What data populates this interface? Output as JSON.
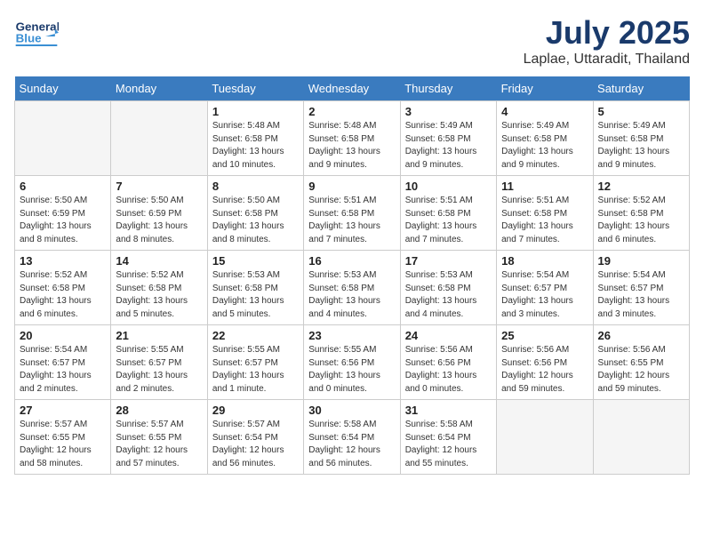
{
  "header": {
    "logo_text_general": "General",
    "logo_text_blue": "Blue",
    "month_year": "July 2025",
    "location": "Laplae, Uttaradit, Thailand"
  },
  "weekdays": [
    "Sunday",
    "Monday",
    "Tuesday",
    "Wednesday",
    "Thursday",
    "Friday",
    "Saturday"
  ],
  "weeks": [
    [
      {
        "day": "",
        "info": ""
      },
      {
        "day": "",
        "info": ""
      },
      {
        "day": "1",
        "info": "Sunrise: 5:48 AM\nSunset: 6:58 PM\nDaylight: 13 hours\nand 10 minutes."
      },
      {
        "day": "2",
        "info": "Sunrise: 5:48 AM\nSunset: 6:58 PM\nDaylight: 13 hours\nand 9 minutes."
      },
      {
        "day": "3",
        "info": "Sunrise: 5:49 AM\nSunset: 6:58 PM\nDaylight: 13 hours\nand 9 minutes."
      },
      {
        "day": "4",
        "info": "Sunrise: 5:49 AM\nSunset: 6:58 PM\nDaylight: 13 hours\nand 9 minutes."
      },
      {
        "day": "5",
        "info": "Sunrise: 5:49 AM\nSunset: 6:58 PM\nDaylight: 13 hours\nand 9 minutes."
      }
    ],
    [
      {
        "day": "6",
        "info": "Sunrise: 5:50 AM\nSunset: 6:59 PM\nDaylight: 13 hours\nand 8 minutes."
      },
      {
        "day": "7",
        "info": "Sunrise: 5:50 AM\nSunset: 6:59 PM\nDaylight: 13 hours\nand 8 minutes."
      },
      {
        "day": "8",
        "info": "Sunrise: 5:50 AM\nSunset: 6:58 PM\nDaylight: 13 hours\nand 8 minutes."
      },
      {
        "day": "9",
        "info": "Sunrise: 5:51 AM\nSunset: 6:58 PM\nDaylight: 13 hours\nand 7 minutes."
      },
      {
        "day": "10",
        "info": "Sunrise: 5:51 AM\nSunset: 6:58 PM\nDaylight: 13 hours\nand 7 minutes."
      },
      {
        "day": "11",
        "info": "Sunrise: 5:51 AM\nSunset: 6:58 PM\nDaylight: 13 hours\nand 7 minutes."
      },
      {
        "day": "12",
        "info": "Sunrise: 5:52 AM\nSunset: 6:58 PM\nDaylight: 13 hours\nand 6 minutes."
      }
    ],
    [
      {
        "day": "13",
        "info": "Sunrise: 5:52 AM\nSunset: 6:58 PM\nDaylight: 13 hours\nand 6 minutes."
      },
      {
        "day": "14",
        "info": "Sunrise: 5:52 AM\nSunset: 6:58 PM\nDaylight: 13 hours\nand 5 minutes."
      },
      {
        "day": "15",
        "info": "Sunrise: 5:53 AM\nSunset: 6:58 PM\nDaylight: 13 hours\nand 5 minutes."
      },
      {
        "day": "16",
        "info": "Sunrise: 5:53 AM\nSunset: 6:58 PM\nDaylight: 13 hours\nand 4 minutes."
      },
      {
        "day": "17",
        "info": "Sunrise: 5:53 AM\nSunset: 6:58 PM\nDaylight: 13 hours\nand 4 minutes."
      },
      {
        "day": "18",
        "info": "Sunrise: 5:54 AM\nSunset: 6:57 PM\nDaylight: 13 hours\nand 3 minutes."
      },
      {
        "day": "19",
        "info": "Sunrise: 5:54 AM\nSunset: 6:57 PM\nDaylight: 13 hours\nand 3 minutes."
      }
    ],
    [
      {
        "day": "20",
        "info": "Sunrise: 5:54 AM\nSunset: 6:57 PM\nDaylight: 13 hours\nand 2 minutes."
      },
      {
        "day": "21",
        "info": "Sunrise: 5:55 AM\nSunset: 6:57 PM\nDaylight: 13 hours\nand 2 minutes."
      },
      {
        "day": "22",
        "info": "Sunrise: 5:55 AM\nSunset: 6:57 PM\nDaylight: 13 hours\nand 1 minute."
      },
      {
        "day": "23",
        "info": "Sunrise: 5:55 AM\nSunset: 6:56 PM\nDaylight: 13 hours\nand 0 minutes."
      },
      {
        "day": "24",
        "info": "Sunrise: 5:56 AM\nSunset: 6:56 PM\nDaylight: 13 hours\nand 0 minutes."
      },
      {
        "day": "25",
        "info": "Sunrise: 5:56 AM\nSunset: 6:56 PM\nDaylight: 12 hours\nand 59 minutes."
      },
      {
        "day": "26",
        "info": "Sunrise: 5:56 AM\nSunset: 6:55 PM\nDaylight: 12 hours\nand 59 minutes."
      }
    ],
    [
      {
        "day": "27",
        "info": "Sunrise: 5:57 AM\nSunset: 6:55 PM\nDaylight: 12 hours\nand 58 minutes."
      },
      {
        "day": "28",
        "info": "Sunrise: 5:57 AM\nSunset: 6:55 PM\nDaylight: 12 hours\nand 57 minutes."
      },
      {
        "day": "29",
        "info": "Sunrise: 5:57 AM\nSunset: 6:54 PM\nDaylight: 12 hours\nand 56 minutes."
      },
      {
        "day": "30",
        "info": "Sunrise: 5:58 AM\nSunset: 6:54 PM\nDaylight: 12 hours\nand 56 minutes."
      },
      {
        "day": "31",
        "info": "Sunrise: 5:58 AM\nSunset: 6:54 PM\nDaylight: 12 hours\nand 55 minutes."
      },
      {
        "day": "",
        "info": ""
      },
      {
        "day": "",
        "info": ""
      }
    ]
  ]
}
